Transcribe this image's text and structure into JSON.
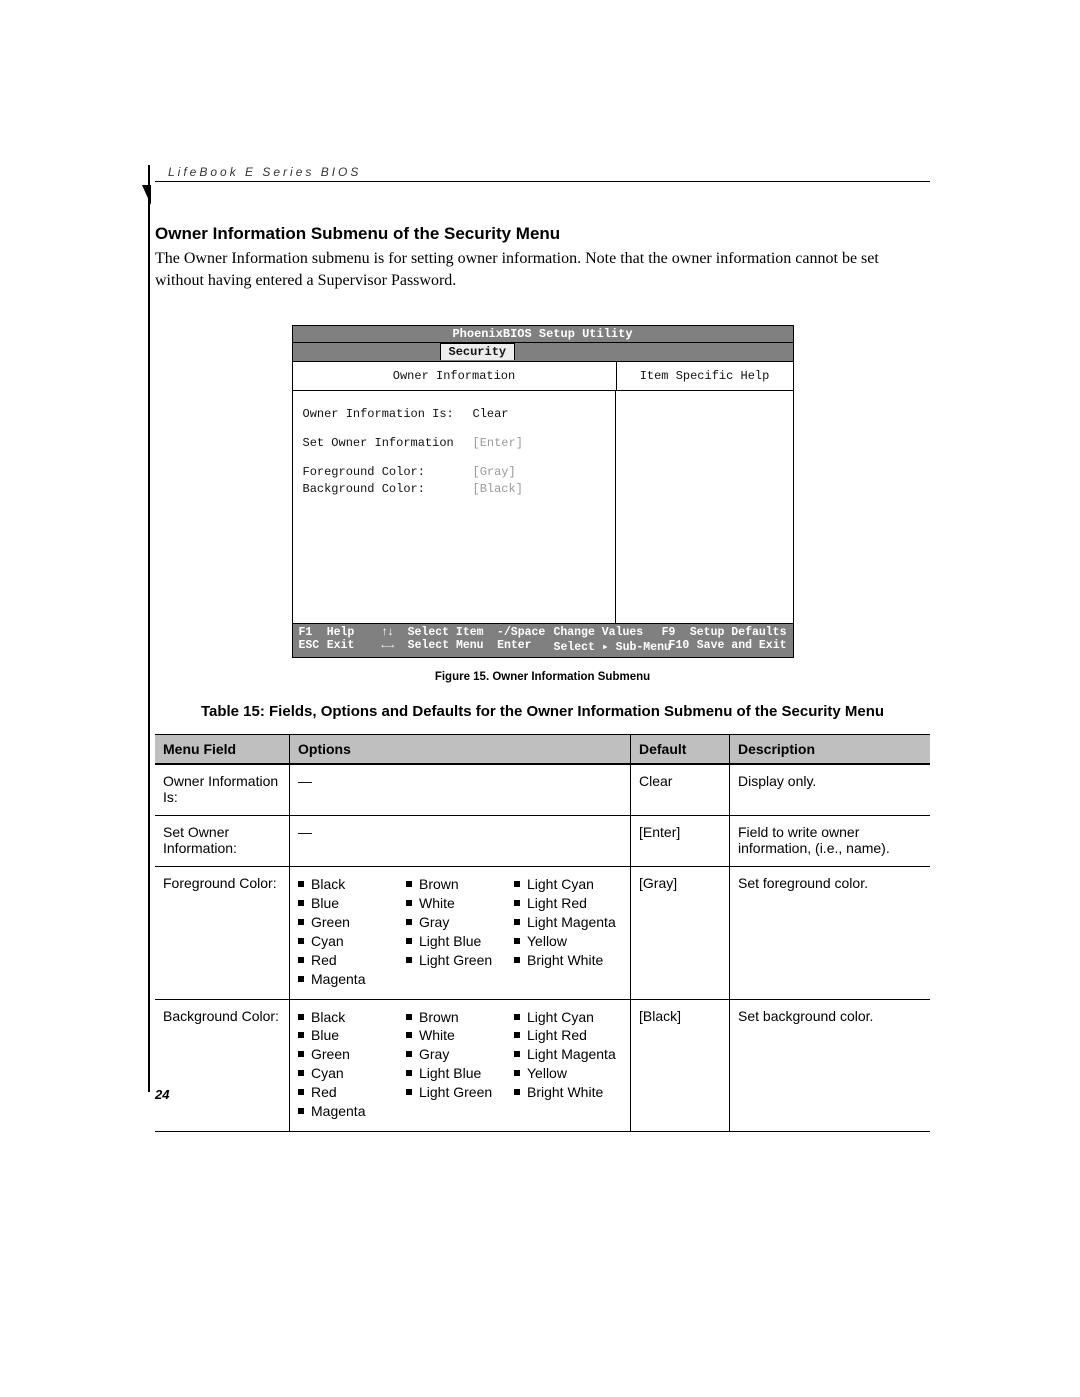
{
  "running_head": "LifeBook E Series BIOS",
  "heading": "Owner Information Submenu of the Security Menu",
  "paragraph": "The Owner Information submenu is for setting owner information. Note that the owner information cannot be set without having entered a Supervisor Password.",
  "bios": {
    "title": "PhoenixBIOS Setup Utility",
    "tab": "Security",
    "left_header": "Owner Information",
    "right_header": "Item Specific Help",
    "rows": [
      {
        "label": "Owner Information Is:",
        "value": "Clear",
        "dim": false
      },
      {
        "label": "Set Owner Information",
        "value": "[Enter]",
        "dim": true
      },
      {
        "label": "Foreground Color:",
        "value": "[Gray]",
        "dim": true
      },
      {
        "label": "Background Color:",
        "value": "[Black]",
        "dim": true
      }
    ],
    "footer": {
      "line1": {
        "k1": "F1",
        "l1": "Help",
        "arrows": "↑↓",
        "al": "Select Item",
        "ck": "-/Space",
        "cl": "Change Values",
        "rk": "F9",
        "rl": "Setup Defaults"
      },
      "line2": {
        "k1": "ESC",
        "l1": "Exit",
        "arrows": "←→",
        "al": "Select Menu",
        "ck": "Enter",
        "cl": "Select ▸ Sub-Menu",
        "rk": "F10",
        "rl": "Save and Exit"
      }
    }
  },
  "figure_caption": "Figure 15.  Owner Information Submenu",
  "table_title": "Table 15: Fields, Options and Defaults for the Owner Information Submenu of the Security Menu",
  "columns": {
    "field": "Menu Field",
    "options": "Options",
    "default": "Default",
    "desc": "Description"
  },
  "rows": [
    {
      "field": "Owner Information Is:",
      "options_dash": "—",
      "default": "Clear",
      "desc": "Display only."
    },
    {
      "field": "Set Owner Information:",
      "options_dash": "—",
      "default": "[Enter]",
      "desc": "Field to write owner information, (i.e., name)."
    },
    {
      "field": "Foreground Color:",
      "options_list": [
        [
          "Black",
          "Blue",
          "Green",
          "Cyan",
          "Red",
          "Magenta"
        ],
        [
          "Brown",
          "White",
          "Gray",
          "Light Blue",
          "Light Green"
        ],
        [
          "Light Cyan",
          "Light Red",
          "Light Magenta",
          "Yellow",
          "Bright White"
        ]
      ],
      "default": "[Gray]",
      "desc": "Set foreground color."
    },
    {
      "field": "Background Color:",
      "options_list": [
        [
          "Black",
          "Blue",
          "Green",
          "Cyan",
          "Red",
          "Magenta"
        ],
        [
          "Brown",
          "White",
          "Gray",
          "Light Blue",
          "Light Green"
        ],
        [
          "Light Cyan",
          "Light Red",
          "Light Magenta",
          "Yellow",
          "Bright White"
        ]
      ],
      "default": "[Black]",
      "desc": "Set background color."
    }
  ],
  "page_number": "24"
}
